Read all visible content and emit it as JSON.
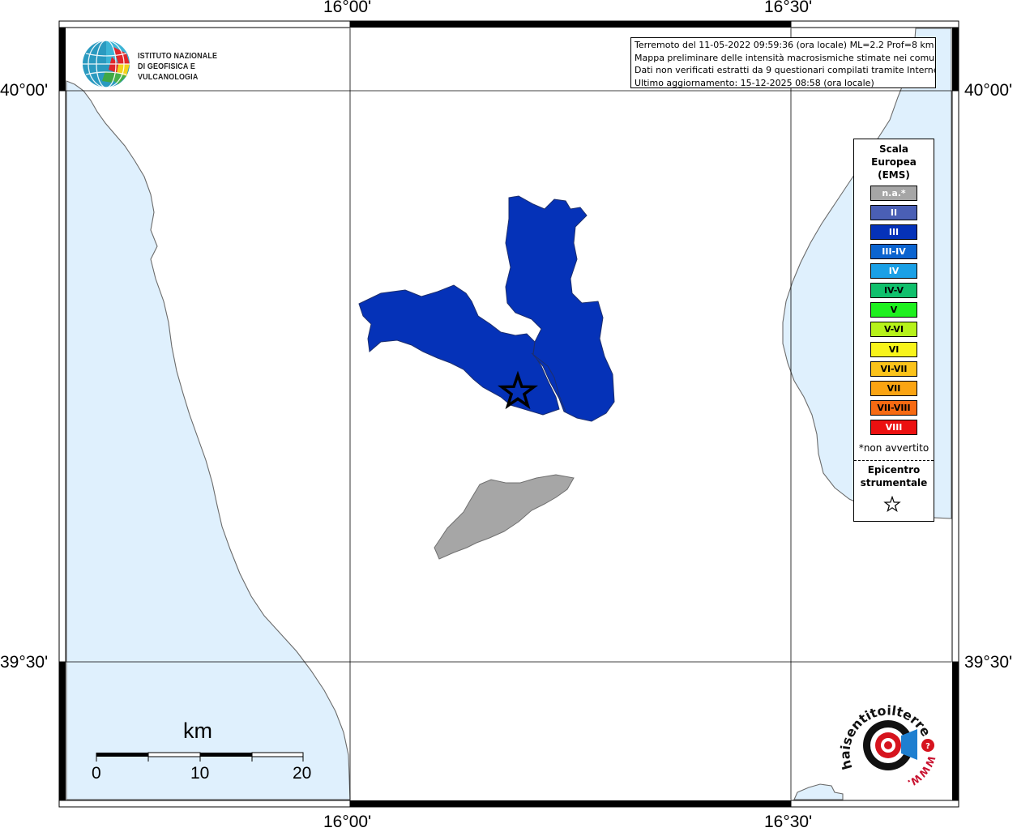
{
  "map": {
    "lon_labels": [
      "16°00'",
      "16°30'"
    ],
    "lat_labels": [
      "40°00'",
      "39°30'"
    ],
    "colors": {
      "sea": "#dff0fd",
      "land": "#ffffff",
      "coast": "#6b6b6b",
      "intensity_III": "#0532b8",
      "not_felt": "#a6a6a6"
    }
  },
  "logo": {
    "line1": "ISTITUTO NAZIONALE",
    "line2": "DI GEOFISICA E VULCANOLOGIA"
  },
  "info": {
    "line1": "Terremoto del 11-05-2022 09:59:36 (ora locale) ML=2.2 Prof=8 km",
    "line2": "Mappa preliminare delle intensità macrosismiche stimate nei comuni",
    "line3": "Dati non verificati estratti da 9 questionari compilati tramite Internet.",
    "line4": "Ultimo aggiornamento: 15-12-2025 08:58 (ora locale)"
  },
  "legend": {
    "title_1": "Scala",
    "title_2": "Europea",
    "title_3": "(EMS)",
    "items": [
      {
        "label": "n.a.*",
        "color": "#a6a6a6",
        "text_color": "#ffffff"
      },
      {
        "label": "II",
        "color": "#4a5fb5",
        "text_color": "#ffffff"
      },
      {
        "label": "III",
        "color": "#0532b8",
        "text_color": "#ffffff"
      },
      {
        "label": "III-IV",
        "color": "#0b64d0",
        "text_color": "#ffffff"
      },
      {
        "label": "IV",
        "color": "#1aa0e6",
        "text_color": "#ffffff"
      },
      {
        "label": "IV-V",
        "color": "#10c06c",
        "text_color": "#000000"
      },
      {
        "label": "V",
        "color": "#1ff01f",
        "text_color": "#000000"
      },
      {
        "label": "V-VI",
        "color": "#b6f21a",
        "text_color": "#000000"
      },
      {
        "label": "VI",
        "color": "#f8f41a",
        "text_color": "#000000"
      },
      {
        "label": "VI-VII",
        "color": "#fbc31a",
        "text_color": "#000000"
      },
      {
        "label": "VII",
        "color": "#fba412",
        "text_color": "#000000"
      },
      {
        "label": "VII-VIII",
        "color": "#f76a12",
        "text_color": "#000000"
      },
      {
        "label": "VIII",
        "color": "#ec1010",
        "text_color": "#ffffff"
      }
    ],
    "note": "*non avvertito",
    "epicenter_1": "Epicentro",
    "epicenter_2": "strumentale"
  },
  "scalebar": {
    "unit": "km",
    "labels": [
      "0",
      "10",
      "20"
    ]
  },
  "site": {
    "text": "haisentitoilterremoto.it",
    "www": "WWW."
  }
}
